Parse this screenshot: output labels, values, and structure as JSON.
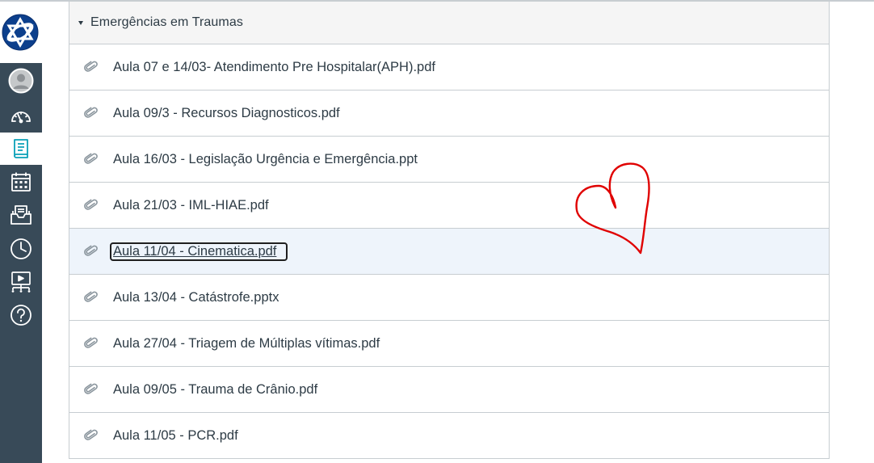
{
  "nav": {
    "items": [
      {
        "name": "account-icon",
        "active": false
      },
      {
        "name": "dashboard-icon",
        "active": false
      },
      {
        "name": "courses-icon",
        "active": true
      },
      {
        "name": "calendar-icon",
        "active": false
      },
      {
        "name": "inbox-icon",
        "active": false
      },
      {
        "name": "history-icon",
        "active": false
      },
      {
        "name": "commons-icon",
        "active": false
      },
      {
        "name": "help-icon",
        "active": false
      }
    ],
    "colors": {
      "background": "#384a58",
      "accent": "#0aa0b8",
      "icon": "#ffffff"
    }
  },
  "module": {
    "title": "Emergências em Traumas",
    "items": [
      {
        "title": "Aula 07 e 14/03- Atendimento Pre Hospitalar(APH).pdf"
      },
      {
        "title": "Aula 09/3 - Recursos Diagnosticos.pdf"
      },
      {
        "title": "Aula 16/03 - Legislação Urgência e Emergência.ppt"
      },
      {
        "title": "Aula 21/03 - IML-HIAE.pdf"
      },
      {
        "title": "Aula 11/04 - Cinematica.pdf",
        "focused": true
      },
      {
        "title": "Aula 13/04 - Catástrofe.pptx"
      },
      {
        "title": "Aula 27/04 - Triagem de Múltiplas vítimas.pdf"
      },
      {
        "title": "Aula 09/05 - Trauma de Crânio.pdf"
      },
      {
        "title": "Aula 11/05 - PCR.pdf"
      }
    ]
  },
  "annotation": {
    "icon": "heart-doodle-icon",
    "color": "#e00000"
  }
}
